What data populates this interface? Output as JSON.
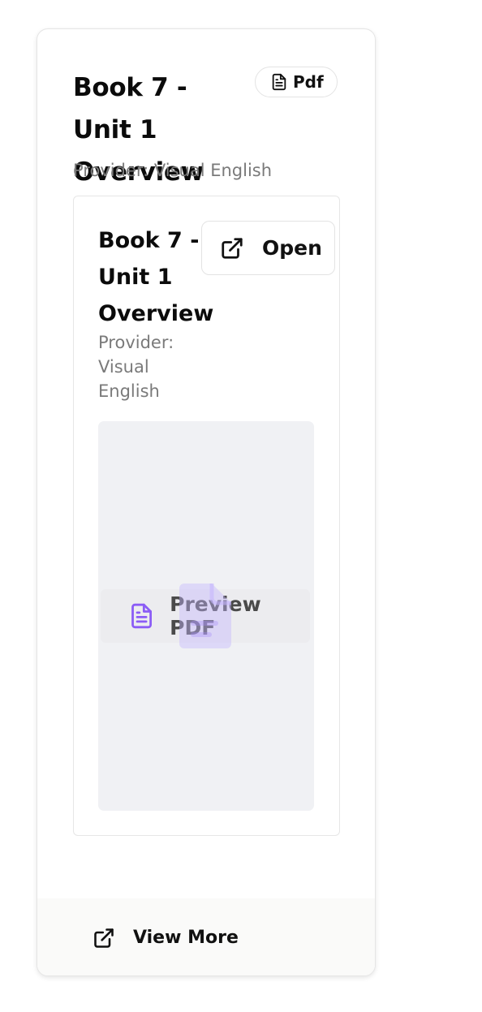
{
  "card": {
    "title": "Book 7 - Unit 1 Overview",
    "type_badge": "Pdf",
    "provider": "Provider: Visual English"
  },
  "inner": {
    "title": "Book 7 - Unit 1 Overview",
    "provider": "Provider: Visual English",
    "open_label": "Open",
    "preview_label": "Preview PDF"
  },
  "footer": {
    "view_more_label": "View More"
  },
  "icons": {
    "badge": "file-text-icon",
    "open": "external-link-icon",
    "preview": "file-text-icon",
    "watermark": "file-icon",
    "view_more": "external-link-icon"
  },
  "colors": {
    "accent_purple": "#8b5cf6",
    "preview_bg": "#f0f1f4",
    "muted_text": "#7a7a7a"
  }
}
